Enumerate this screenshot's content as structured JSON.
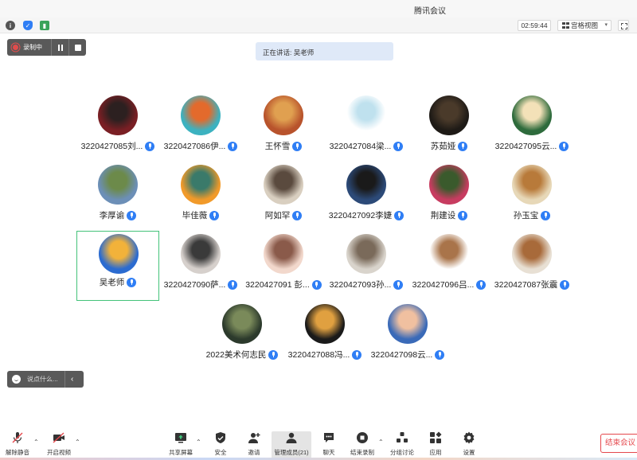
{
  "window": {
    "title": "腾讯会议"
  },
  "topbar": {
    "timer": "02:59:44",
    "view_label": "宫格视图"
  },
  "recording": {
    "label": "录制中"
  },
  "speaking": {
    "text": "正在讲话: 吴老师"
  },
  "participants": [
    {
      "name": "3220427085刘...",
      "avatar_colors": [
        "#7a1f24",
        "#2c2020"
      ]
    },
    {
      "name": "3220427086伊...",
      "avatar_colors": [
        "#3cb2c0",
        "#e36a2c"
      ]
    },
    {
      "name": "王怀雪",
      "avatar_colors": [
        "#b8532c",
        "#e0a050"
      ]
    },
    {
      "name": "3220427084梁...",
      "avatar_colors": [
        "#ffffff",
        "#bfe1ee"
      ]
    },
    {
      "name": "苏茹娅",
      "avatar_colors": [
        "#1e1a16",
        "#4a3a2a"
      ]
    },
    {
      "name": "3220427095云...",
      "avatar_colors": [
        "#2e6b3c",
        "#f3e1b8"
      ]
    },
    {
      "name": "李厚谕",
      "avatar_colors": [
        "#6c8fb7",
        "#6c8a4a"
      ]
    },
    {
      "name": "毕佳薇",
      "avatar_colors": [
        "#f19a2a",
        "#3a7a6a"
      ]
    },
    {
      "name": "阿如罕",
      "avatar_colors": [
        "#d9cfc0",
        "#5a4a3e"
      ]
    },
    {
      "name": "3220427092李婕",
      "avatar_colors": [
        "#2c4a78",
        "#1a1a1a"
      ]
    },
    {
      "name": "荆建设",
      "avatar_colors": [
        "#c73c60",
        "#3a5a2c"
      ]
    },
    {
      "name": "孙玉宝",
      "avatar_colors": [
        "#e7d8b8",
        "#b87a3a"
      ]
    },
    {
      "name": "吴老师",
      "avatar_colors": [
        "#2b6bd0",
        "#f2b23a"
      ],
      "active": true
    },
    {
      "name": "3220427090萨...",
      "avatar_colors": [
        "#d6d0cc",
        "#3a3a3a"
      ]
    },
    {
      "name": "3220427091 彭...",
      "avatar_colors": [
        "#f2d8cc",
        "#8a5a4a"
      ]
    },
    {
      "name": "3220427093孙...",
      "avatar_colors": [
        "#d9d4cc",
        "#7a6a5a"
      ]
    },
    {
      "name": "3220427096吕...",
      "avatar_colors": [
        "#ffffff",
        "#a9744a"
      ]
    },
    {
      "name": "3220427087张震",
      "avatar_colors": [
        "#e8e0d4",
        "#a86a3a"
      ]
    },
    {
      "name": "2022美术何志民",
      "avatar_colors": [
        "#2c3a2c",
        "#7a8a5a"
      ]
    },
    {
      "name": "3220427088冯...",
      "avatar_colors": [
        "#1a1a1a",
        "#e0a040"
      ]
    },
    {
      "name": "3220427098云...",
      "avatar_colors": [
        "#3a6ab8",
        "#f0c0a0"
      ]
    }
  ],
  "chat": {
    "placeholder": "说点什么..."
  },
  "toolbar": {
    "mute": "解除静音",
    "video": "开启视频",
    "share": "共享屏幕",
    "security": "安全",
    "invite": "邀请",
    "members": "管理成员(21)",
    "chat": "聊天",
    "end_record": "结束录制",
    "breakout": "分组讨论",
    "apps": "应用",
    "settings": "设置",
    "end_meeting": "结束会议"
  }
}
